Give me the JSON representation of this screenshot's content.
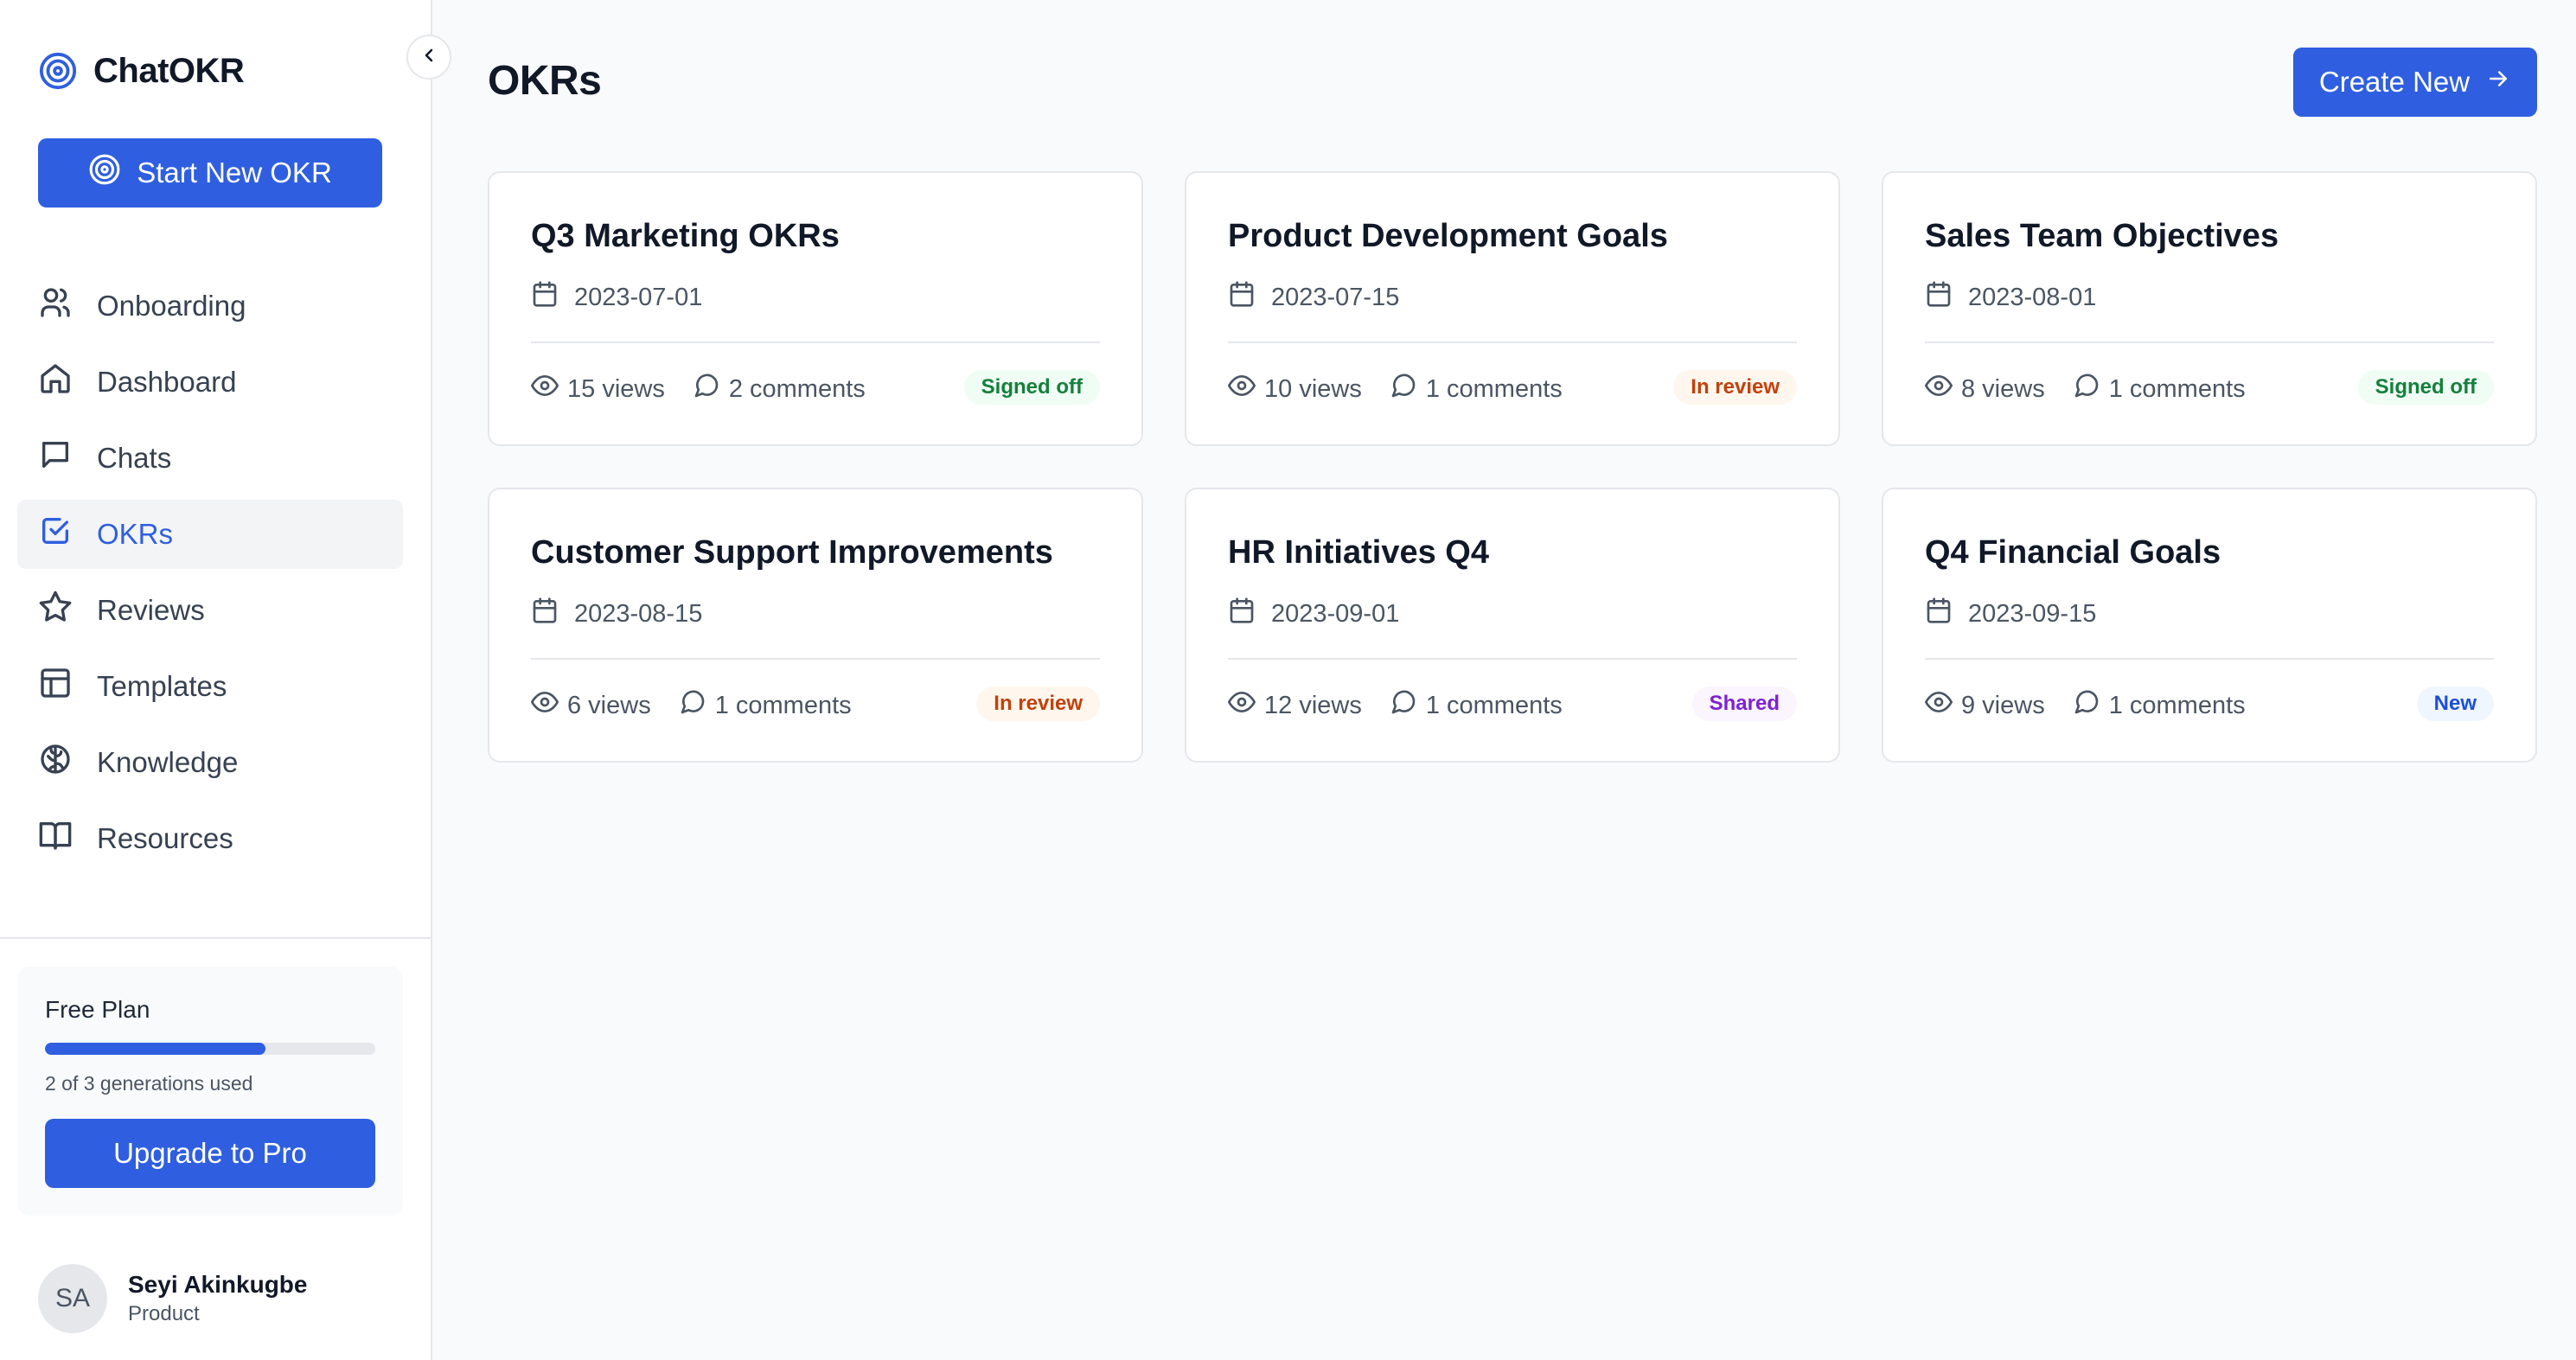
{
  "app": {
    "name": "ChatOKR"
  },
  "sidebar": {
    "start_button": "Start New OKR",
    "items": [
      {
        "label": "Onboarding",
        "icon": "users-icon",
        "active": false
      },
      {
        "label": "Dashboard",
        "icon": "home-icon",
        "active": false
      },
      {
        "label": "Chats",
        "icon": "message-icon",
        "active": false
      },
      {
        "label": "OKRs",
        "icon": "checkbox-icon",
        "active": true
      },
      {
        "label": "Reviews",
        "icon": "star-icon",
        "active": false
      },
      {
        "label": "Templates",
        "icon": "layout-icon",
        "active": false
      },
      {
        "label": "Knowledge",
        "icon": "brain-icon",
        "active": false
      },
      {
        "label": "Resources",
        "icon": "book-icon",
        "active": false
      }
    ],
    "plan": {
      "title": "Free Plan",
      "usage": "2 of 3 generations used",
      "progress": 0.6667,
      "upgrade_button": "Upgrade to Pro"
    },
    "user": {
      "initials": "SA",
      "name": "Seyi Akinkugbe",
      "role": "Product"
    }
  },
  "main": {
    "title": "OKRs",
    "create_button": "Create New",
    "cards": [
      {
        "title": "Q3 Marketing OKRs",
        "date": "2023-07-01",
        "views": "15 views",
        "comments": "2 comments",
        "status": "Signed off",
        "status_color": "green"
      },
      {
        "title": "Product Development Goals",
        "date": "2023-07-15",
        "views": "10 views",
        "comments": "1 comments",
        "status": "In review",
        "status_color": "orange"
      },
      {
        "title": "Sales Team Objectives",
        "date": "2023-08-01",
        "views": "8 views",
        "comments": "1 comments",
        "status": "Signed off",
        "status_color": "green"
      },
      {
        "title": "Customer Support Improvements",
        "date": "2023-08-15",
        "views": "6 views",
        "comments": "1 comments",
        "status": "In review",
        "status_color": "orange"
      },
      {
        "title": "HR Initiatives Q4",
        "date": "2023-09-01",
        "views": "12 views",
        "comments": "1 comments",
        "status": "Shared",
        "status_color": "purple"
      },
      {
        "title": "Q4 Financial Goals",
        "date": "2023-09-15",
        "views": "9 views",
        "comments": "1 comments",
        "status": "New",
        "status_color": "blue"
      }
    ]
  },
  "colors": {
    "accent": "#2f5fe0"
  }
}
